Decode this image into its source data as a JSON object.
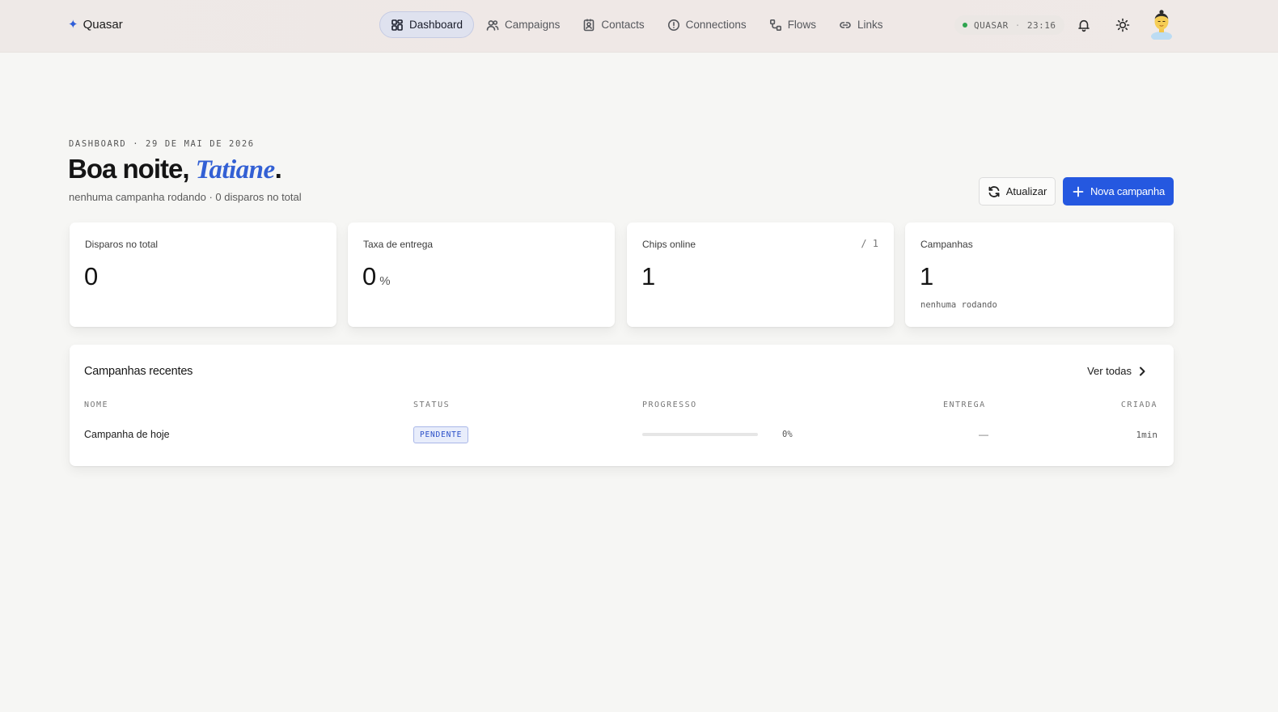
{
  "brand": {
    "name": "Quasar"
  },
  "nav": {
    "items": [
      {
        "label": "Dashboard",
        "icon": "grid-icon",
        "active": true
      },
      {
        "label": "Campaigns",
        "icon": "users-icon",
        "active": false
      },
      {
        "label": "Contacts",
        "icon": "contact-book-icon",
        "active": false
      },
      {
        "label": "Connections",
        "icon": "alert-circle-icon",
        "active": false
      },
      {
        "label": "Flows",
        "icon": "flow-icon",
        "active": false
      },
      {
        "label": "Links",
        "icon": "link-icon",
        "active": false
      }
    ]
  },
  "status": {
    "instance": "QUASAR",
    "separator": "·",
    "time": "23:16",
    "color": "#2ea44f"
  },
  "header": {
    "eyebrow": "DASHBOARD · 29 DE MAI DE 2026",
    "greeting_prefix": "Boa noite, ",
    "user_name": "Tatiane",
    "greeting_suffix": ".",
    "subline": "nenhuma campanha rodando · 0 disparos no total",
    "refresh_label": "Atualizar",
    "new_campaign_label": "Nova campanha"
  },
  "stats": [
    {
      "label": "Disparos no total",
      "value": "0",
      "unit": "",
      "aside": "",
      "note": ""
    },
    {
      "label": "Taxa de entrega",
      "value": "0",
      "unit": "%",
      "aside": "",
      "note": ""
    },
    {
      "label": "Chips online",
      "value": "1",
      "unit": "",
      "aside": "/ 1",
      "note": ""
    },
    {
      "label": "Campanhas",
      "value": "1",
      "unit": "",
      "aside": "",
      "note": "nenhuma rodando"
    }
  ],
  "recent": {
    "title": "Campanhas recentes",
    "see_all_label": "Ver todas",
    "columns": [
      "NOME",
      "STATUS",
      "PROGRESSO",
      "ENTREGA",
      "CRIADA"
    ],
    "rows": [
      {
        "name": "Campanha de hoje",
        "status": "PENDENTE",
        "progress": 0,
        "progress_label": "0%",
        "delivery": "—",
        "created": "1min"
      }
    ]
  },
  "colors": {
    "accent": "#2558e0",
    "accent_name": "#3360d4",
    "background": "#f6f6f4"
  }
}
